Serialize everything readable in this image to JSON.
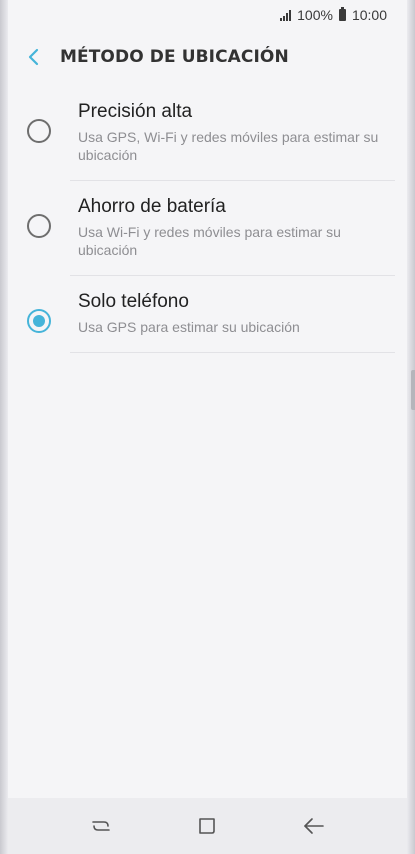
{
  "status_bar": {
    "battery_percent": "100%",
    "time": "10:00",
    "signal_icon": "signal-icon",
    "battery_icon": "battery-icon"
  },
  "header": {
    "back_icon": "chevron-left-icon",
    "title": "MÉTODO DE UBICACIÓN"
  },
  "options": [
    {
      "title": "Precisión alta",
      "description": "Usa GPS, Wi-Fi y redes móviles para estimar su ubicación",
      "selected": false
    },
    {
      "title": "Ahorro de batería",
      "description": "Usa Wi-Fi y redes móviles para estimar su ubicación",
      "selected": false
    },
    {
      "title": "Solo teléfono",
      "description": "Usa GPS para estimar su ubicación",
      "selected": true
    }
  ],
  "navigation": {
    "recents_icon": "recent-apps-icon",
    "home_icon": "home-icon",
    "back_icon": "back-arrow-icon"
  },
  "colors": {
    "accent": "#45b4d9",
    "title_text": "#333333",
    "secondary_text": "#8e8e92"
  }
}
